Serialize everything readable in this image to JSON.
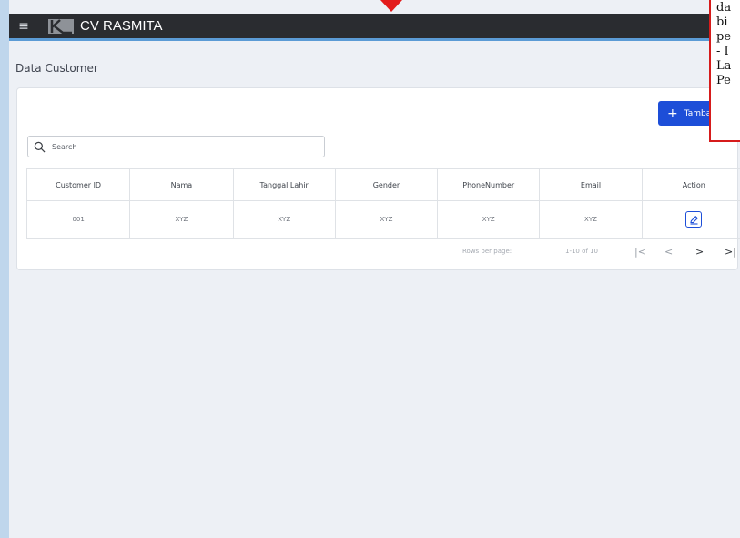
{
  "topbar": {
    "menu_icon": "hamburger-icon",
    "title": "CV RASMITA",
    "accent_color": "#5b9bd5",
    "bg_color": "#2a2c30"
  },
  "page": {
    "title": "Data Customer"
  },
  "toolbar": {
    "add_label": "Tamba",
    "add_icon": "plus-icon",
    "add_color": "#1d4ed8"
  },
  "search": {
    "placeholder": "Search",
    "value": ""
  },
  "table": {
    "headers": [
      "Customer ID",
      "Nama",
      "Tanggal Lahir",
      "Gender",
      "PhoneNumber",
      "Email",
      "Action"
    ],
    "rows": [
      {
        "customer_id": "001",
        "nama": "XYZ",
        "tanggal_lahir": "XYZ",
        "gender": "XYZ",
        "phone": "XYZ",
        "email": "XYZ",
        "action_icon": "edit-icon"
      }
    ]
  },
  "pagination": {
    "rows_per_page_label": "Rows per page:",
    "range": "1-10 of 10",
    "first_icon": "first-page-icon",
    "prev_icon": "chevron-left-icon",
    "next_icon": "chevron-right-icon",
    "last_icon": "last-page-icon"
  },
  "annotation": {
    "lines": [
      "da",
      "bi",
      "pe",
      "- I",
      "La",
      "Pe"
    ],
    "border_color": "#d61b1b"
  }
}
